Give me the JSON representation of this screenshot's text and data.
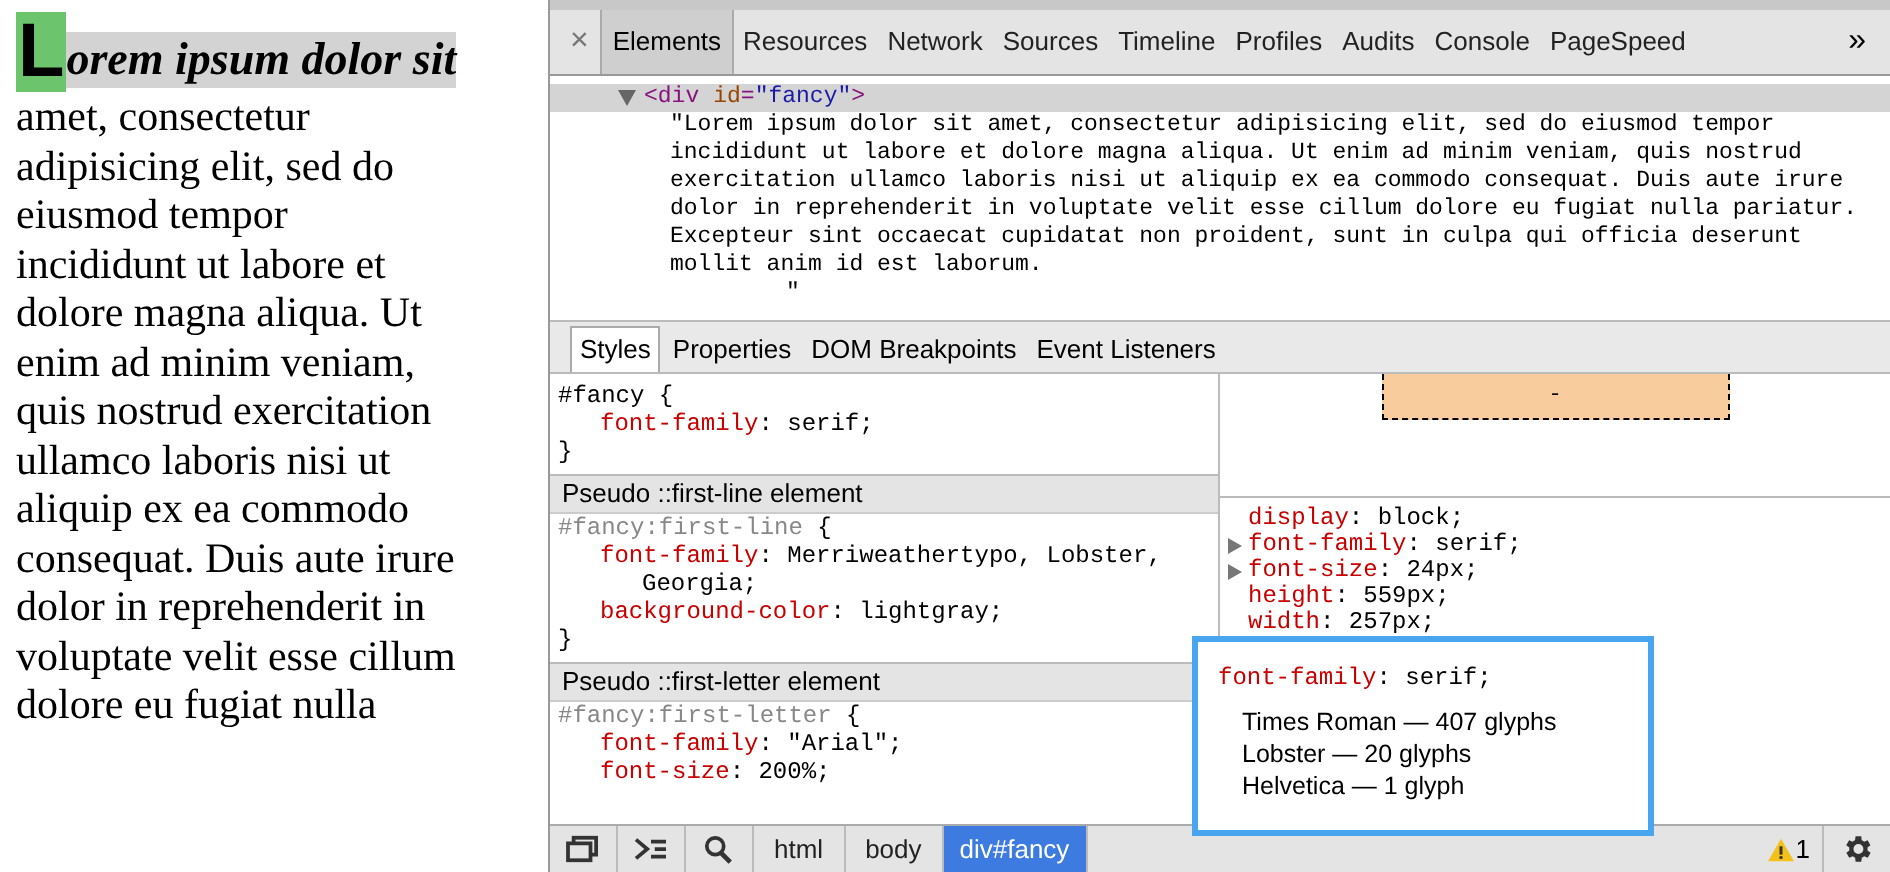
{
  "page": {
    "first_letter": "L",
    "first_line": "orem ipsum dolor sit",
    "lines": [
      "amet, consectetur",
      "adipisicing elit, sed do",
      "eiusmod tempor",
      "incididunt ut labore et",
      "dolore magna aliqua. Ut",
      "enim ad minim veniam,",
      "quis nostrud exercitation",
      "ullamco laboris nisi ut",
      "aliquip ex ea commodo",
      "consequat. Duis aute irure",
      "dolor in reprehenderit in",
      "voluptate velit esse cillum",
      "dolore eu fugiat nulla"
    ]
  },
  "close": "×",
  "tabs": [
    {
      "label": "Elements",
      "selected": true
    },
    {
      "label": "Resources",
      "selected": false
    },
    {
      "label": "Network",
      "selected": false
    },
    {
      "label": "Sources",
      "selected": false
    },
    {
      "label": "Timeline",
      "selected": false
    },
    {
      "label": "Profiles",
      "selected": false
    },
    {
      "label": "Audits",
      "selected": false
    },
    {
      "label": "Console",
      "selected": false
    },
    {
      "label": "PageSpeed",
      "selected": false
    }
  ],
  "more": "»",
  "dom": {
    "node_parts": [
      {
        "kind": "tag",
        "text": "<div"
      },
      {
        "kind": "attr",
        "text": "id"
      },
      {
        "kind": "punct",
        "text": "="
      },
      {
        "kind": "value",
        "text": "\"fancy\""
      },
      {
        "kind": "tag",
        "text": ">"
      }
    ],
    "text_lines": [
      "\"Lorem ipsum dolor sit amet, consectetur adipisicing elit, sed do eiusmod tempor",
      "incididunt ut labore et dolore magna aliqua. Ut enim ad minim veniam, quis nostrud",
      "exercitation ullamco laboris nisi ut aliquip ex ea commodo consequat. Duis aute irure",
      "dolor in reprehenderit in voluptate velit esse cillum dolore eu fugiat nulla pariatur.",
      "Excepteur sint occaecat cupidatat non proident, sunt in culpa qui officia deserunt",
      "mollit anim id est laborum."
    ],
    "closing_quote": "\""
  },
  "sub_tabs": [
    {
      "label": "Styles",
      "selected": true
    },
    {
      "label": "Properties",
      "selected": false
    },
    {
      "label": "DOM Breakpoints",
      "selected": false
    },
    {
      "label": "Event Listeners",
      "selected": false
    }
  ],
  "style_rules": [
    {
      "kind": "selector",
      "text": "#fancy {"
    },
    {
      "kind": "prop",
      "name": "font-family",
      "value": ": serif;"
    },
    {
      "kind": "brace",
      "text": "}"
    },
    {
      "kind": "section",
      "text": "Pseudo ::first-line element"
    },
    {
      "kind": "pseudo_selector",
      "text": "#fancy:first-line",
      "brace": "{"
    },
    {
      "kind": "prop",
      "name": "font-family",
      "value": ": Merriweathertypo, Lobster,"
    },
    {
      "kind": "cont",
      "text": "Georgia;"
    },
    {
      "kind": "prop",
      "name": "background-color",
      "value": ": lightgray;"
    },
    {
      "kind": "brace",
      "text": "}"
    },
    {
      "kind": "section",
      "text": "Pseudo ::first-letter element"
    },
    {
      "kind": "pseudo_selector",
      "text": "#fancy:first-letter",
      "brace": "{"
    },
    {
      "kind": "prop",
      "name": "font-family",
      "value": ": \"Arial\";"
    },
    {
      "kind": "prop",
      "name": "font-size",
      "value": ": 200%;"
    }
  ],
  "box_model": {
    "value": "-"
  },
  "computed": [
    {
      "name": "display",
      "value": ": block;",
      "expandable": false
    },
    {
      "name": "font-family",
      "value": ": serif;",
      "expandable": true
    },
    {
      "name": "font-size",
      "value": ": 24px;",
      "expandable": true
    },
    {
      "name": "height",
      "value": ": 559px;",
      "expandable": false
    },
    {
      "name": "width",
      "value": ": 257px;",
      "expandable": false
    }
  ],
  "font_popover": {
    "name": "font-family",
    "value": ": serif;",
    "fonts": [
      "Times Roman — 407 glyphs",
      "Lobster — 20 glyphs",
      "Helvetica — 1 glyph"
    ]
  },
  "breadcrumbs": [
    {
      "label": "html",
      "selected": false
    },
    {
      "label": "body",
      "selected": false
    },
    {
      "label": "div#fancy",
      "selected": true
    }
  ],
  "warnings": "1"
}
